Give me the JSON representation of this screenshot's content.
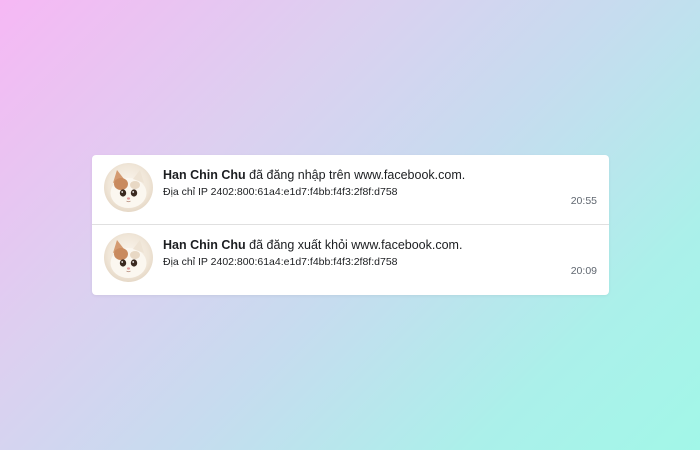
{
  "notifications": [
    {
      "name": "Han Chin Chu",
      "message": " đã đăng nhập trên www.facebook.com.",
      "ip": "Địa chỉ IP 2402:800:61a4:e1d7:f4bb:f4f3:2f8f:d758",
      "time": "20:55",
      "avatar_icon": "cat-avatar-icon"
    },
    {
      "name": "Han Chin Chu",
      "message": " đã đăng xuất khỏi www.facebook.com.",
      "ip": "Địa chỉ IP 2402:800:61a4:e1d7:f4bb:f4f3:2f8f:d758",
      "time": "20:09",
      "avatar_icon": "cat-avatar-icon"
    }
  ],
  "colors": {
    "card_background": "#ffffff",
    "text": "#1c1e21",
    "time_text": "#606770",
    "divider": "#e0e0e0"
  }
}
